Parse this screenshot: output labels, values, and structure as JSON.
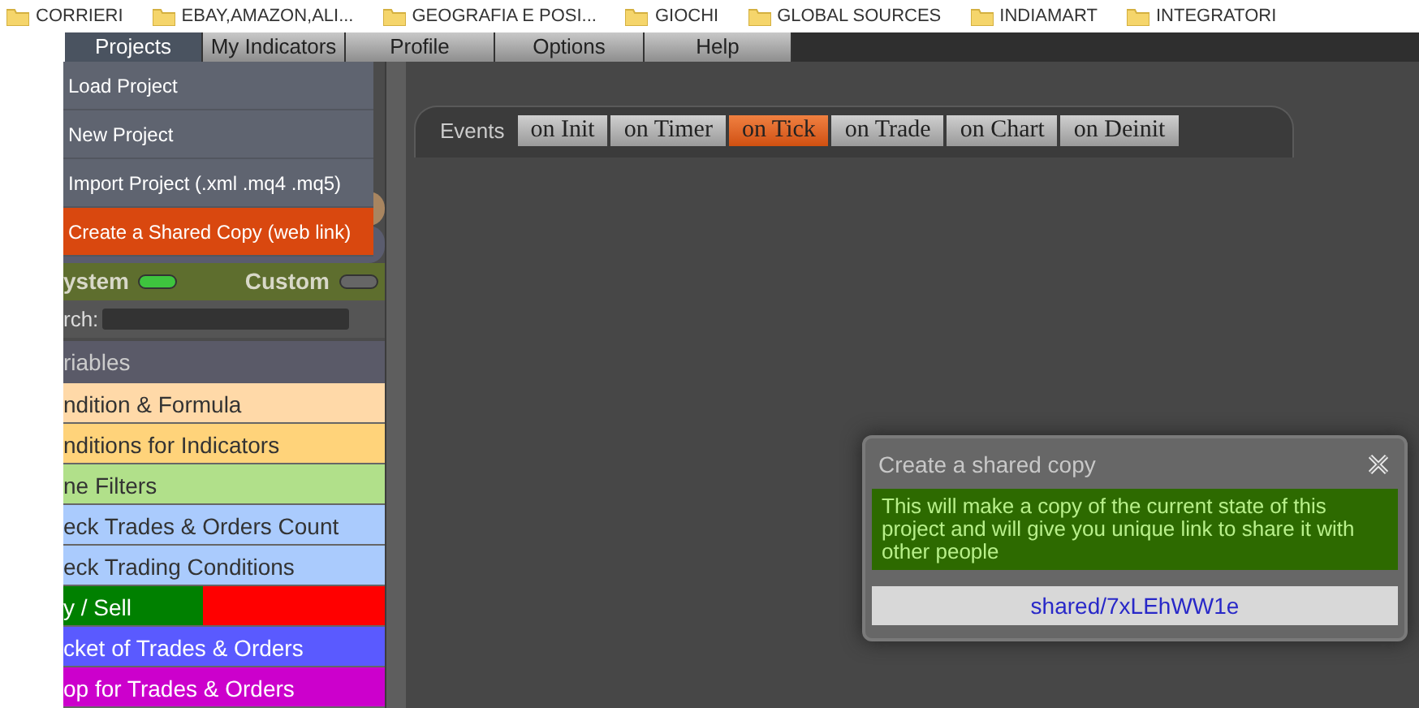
{
  "bookmarks": [
    {
      "label": "CORRIERI"
    },
    {
      "label": "EBAY,AMAZON,ALI..."
    },
    {
      "label": "GEOGRAFIA E POSI..."
    },
    {
      "label": "GIOCHI"
    },
    {
      "label": "GLOBAL SOURCES"
    },
    {
      "label": "INDIAMART"
    },
    {
      "label": "INTEGRATORI"
    }
  ],
  "menu": [
    {
      "label": "Projects",
      "selected": true
    },
    {
      "label": "My Indicators",
      "selected": false
    },
    {
      "label": "Profile",
      "selected": false
    },
    {
      "label": "Options",
      "selected": false
    },
    {
      "label": "Help",
      "selected": false
    }
  ],
  "dropdown": [
    {
      "label": "Load Project",
      "selected": false
    },
    {
      "label": "New Project",
      "selected": false
    },
    {
      "label": "Import Project (.xml .mq4 .mq5)",
      "selected": false
    },
    {
      "label": "Create a Shared Copy (web link)",
      "selected": true
    }
  ],
  "toggles": [
    {
      "label": "ystem",
      "on": true
    },
    {
      "label": "Custom",
      "on": false
    }
  ],
  "search": {
    "label": "rch:"
  },
  "section": "riables",
  "blocks": [
    {
      "label": "ndition & Formula",
      "color": "#ffd9a8"
    },
    {
      "label": "nditions for Indicators",
      "color": "#ffd37a"
    },
    {
      "label": "ne Filters",
      "color": "#b1e08a"
    },
    {
      "label": "eck Trades & Orders Count",
      "color": "#aacbfd"
    },
    {
      "label": "eck Trading Conditions",
      "color": "#aacbfd"
    },
    {
      "label": "y / Sell",
      "color": "#008000",
      "kind": "split",
      "right": {
        "color": "#ff0000"
      }
    },
    {
      "label": "cket of Trades & Orders",
      "color": "#5a5aff"
    },
    {
      "label": "op for Trades & Orders",
      "color": "#cc00cc"
    }
  ],
  "events": {
    "label": "Events",
    "tabs": [
      {
        "label": "on Init",
        "selected": false
      },
      {
        "label": "on Timer",
        "selected": false
      },
      {
        "label": "on Tick",
        "selected": true
      },
      {
        "label": "on Trade",
        "selected": false
      },
      {
        "label": "on Chart",
        "selected": false
      },
      {
        "label": "on Deinit",
        "selected": false
      }
    ]
  },
  "dialog": {
    "title": "Create a shared copy",
    "message": "This will make a copy of the current state of this project and will give you unique link to share it with other people",
    "link": "shared/7xLEhWW1e"
  }
}
